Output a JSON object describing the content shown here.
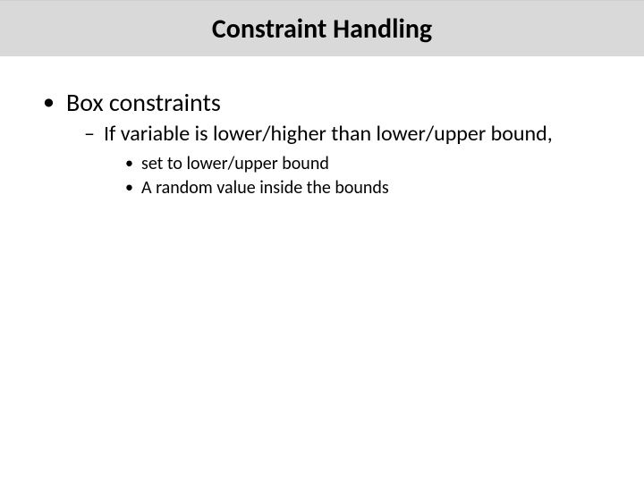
{
  "title": "Constraint Handling",
  "bullets": {
    "l1": "Box constraints",
    "l2": "If variable is lower/higher than lower/upper bound,",
    "l3a": "set to lower/upper bound",
    "l3b": "A random value inside the bounds"
  }
}
